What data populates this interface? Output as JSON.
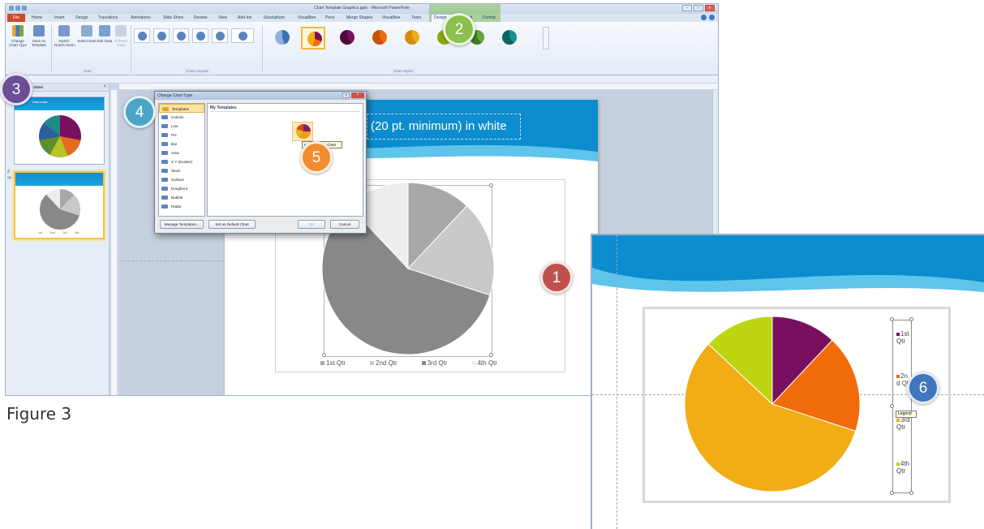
{
  "window": {
    "title": "Chart Template Graphics.pptx - Microsoft PowerPoint",
    "tabs": [
      "File",
      "Home",
      "Insert",
      "Design",
      "Transitions",
      "Animations",
      "Slide Show",
      "Review",
      "View",
      "Add-Ins",
      "iStockphoto",
      "VisualBee",
      "Pens",
      "Merge Shapes",
      "VisualBee",
      "Team",
      "Design",
      "Layout",
      "Format"
    ]
  },
  "ribbon": {
    "change_chart_type": "Change Chart Type",
    "save_as_template": "Save As Template",
    "switch_row_column": "Switch Row/Column",
    "select_data": "Select Data",
    "edit_data": "Edit Data",
    "refresh_data": "Refresh Data",
    "group_data": "Data",
    "group_chart_layouts": "Chart Layouts",
    "group_chart_styles": "Chart Styles"
  },
  "slides_panel": {
    "tab_label": "Slides",
    "thumb1_title": "Data chart",
    "thumb2_number": "2",
    "thumb2_sub": "Qtr",
    "thumb2_legend": [
      "1st",
      "2nd",
      "3rd",
      "4th"
    ]
  },
  "slide": {
    "title": "(20 pt. minimum) in white",
    "legend": [
      "1st Qtr",
      "2nd Qtr",
      "3rd Qtr",
      "4th Qtr"
    ],
    "colors": {
      "banner": "#0d8ccf",
      "wave": "#5fc4ea"
    }
  },
  "dialog": {
    "title": "Change Chart Type",
    "chart_types": [
      "Templates",
      "Column",
      "Line",
      "Pie",
      "Bar",
      "Area",
      "X Y (Scatter)",
      "Stock",
      "Surface",
      "Doughnut",
      "Bubble",
      "Radar"
    ],
    "selected_type": "Templates",
    "templates_header": "My Templates",
    "template_tooltip": "Company Pie Chart",
    "manage_templates": "Manage Templates...",
    "set_default": "Set as Default Chart",
    "ok": "OK",
    "cancel": "Cancel"
  },
  "inset": {
    "legend": [
      "1st Qtr",
      "2nd Qtr",
      "3rd Qtr",
      "4th Qtr"
    ],
    "legend_tooltip": "Legend",
    "colors": [
      "#7b0f5f",
      "#f26b0a",
      "#f2ac14",
      "#bed612"
    ]
  },
  "callouts": [
    "1",
    "2",
    "3",
    "4",
    "5",
    "6"
  ],
  "callout_colors": {
    "1": "#c0504d",
    "2": "#8bbf4e",
    "3": "#6a4f96",
    "4": "#4aa6c7",
    "5": "#f28c31",
    "6": "#3f76bd"
  },
  "caption": "Figure 3",
  "chart_data": [
    {
      "type": "pie",
      "title": "",
      "categories": [
        "1st Qtr",
        "2nd Qtr",
        "3rd Qtr",
        "4th Qtr"
      ],
      "values": [
        12,
        18,
        58,
        12
      ],
      "colors": [
        "#a8a8a8",
        "#c8c8c8",
        "#888888",
        "#ededed"
      ]
    },
    {
      "type": "pie",
      "title": "",
      "categories": [
        "1st Qtr",
        "2nd Qtr",
        "3rd Qtr",
        "4th Qtr"
      ],
      "values": [
        12,
        18,
        57,
        13
      ],
      "colors": [
        "#7b0f5f",
        "#f26b0a",
        "#f2ac14",
        "#bed612"
      ]
    }
  ]
}
